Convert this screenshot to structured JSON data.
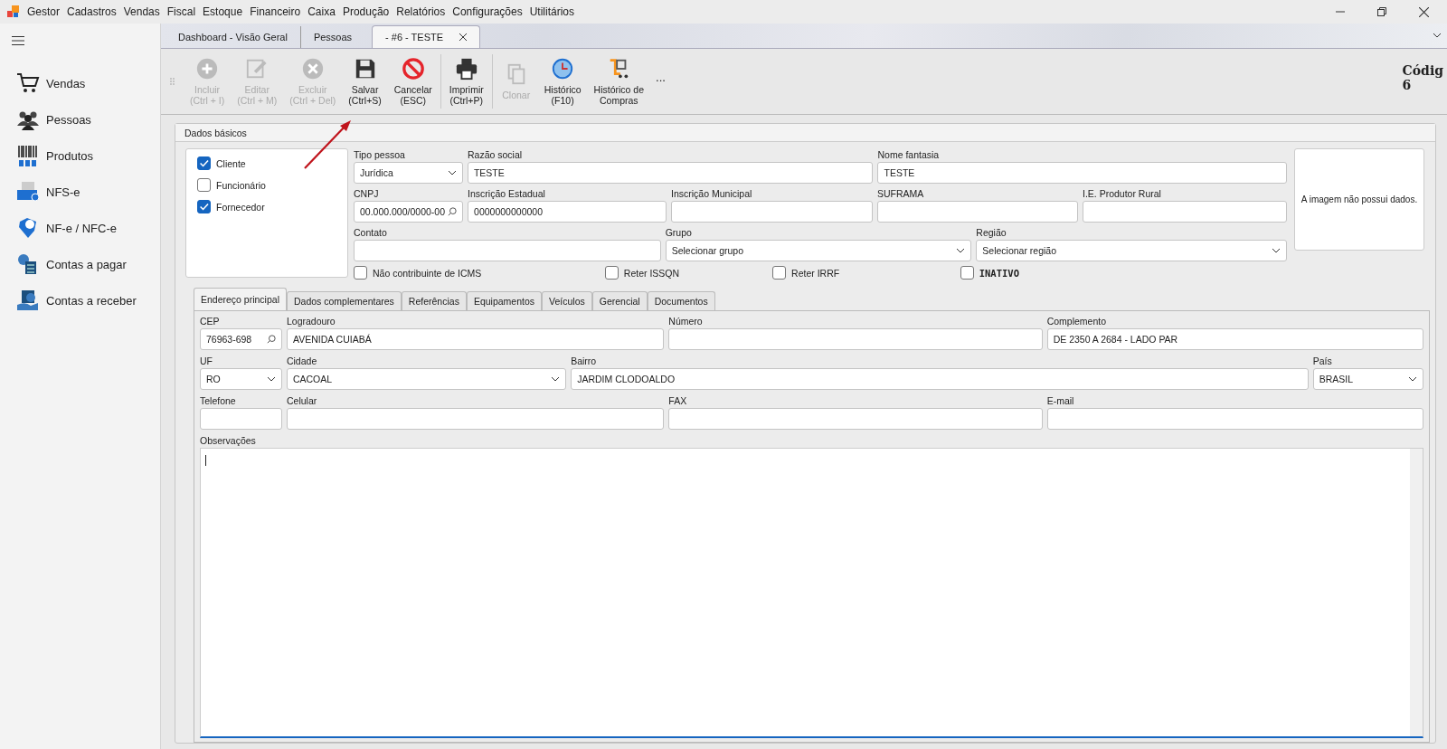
{
  "menu": {
    "app": "Gestor",
    "items": [
      "Cadastros",
      "Vendas",
      "Fiscal",
      "Estoque",
      "Financeiro",
      "Caixa",
      "Produção",
      "Relatórios",
      "Configurações",
      "Utilitários"
    ]
  },
  "doc_tabs": [
    {
      "label": "Dashboard - Visão Geral",
      "selected": false
    },
    {
      "label": "Pessoas",
      "selected": false
    },
    {
      "label": "- #6 - TESTE",
      "selected": true
    }
  ],
  "toolbar": {
    "groups": [
      [
        {
          "kind": "plus",
          "lines": [
            "Incluir",
            "(Ctrl + I)"
          ],
          "disabled": true
        },
        {
          "kind": "edit",
          "lines": [
            "Editar",
            "(Ctrl + M)"
          ],
          "disabled": true
        },
        {
          "kind": "delete",
          "lines": [
            "Excluir",
            "(Ctrl + Del)"
          ],
          "disabled": true
        },
        {
          "kind": "save",
          "lines": [
            "Salvar",
            "(Ctrl+S)"
          ],
          "disabled": false
        },
        {
          "kind": "cancel",
          "lines": [
            "Cancelar",
            "(ESC)"
          ],
          "disabled": false
        }
      ],
      [
        {
          "kind": "print",
          "lines": [
            "Imprimir",
            "(Ctrl+P)"
          ],
          "disabled": false
        }
      ],
      [
        {
          "kind": "clone",
          "lines": [
            "Clonar"
          ],
          "disabled": true
        },
        {
          "kind": "history",
          "lines": [
            "Histórico",
            "(F10)"
          ],
          "disabled": false
        },
        {
          "kind": "purchases",
          "lines": [
            "Histórico de",
            "Compras"
          ],
          "disabled": false
        }
      ]
    ],
    "more": "...",
    "code_label": "Códig",
    "code_value": "6"
  },
  "sidebar": {
    "items": [
      {
        "kind": "cart",
        "label": "Vendas"
      },
      {
        "kind": "people",
        "label": "Pessoas"
      },
      {
        "kind": "barcode",
        "label": "Produtos"
      },
      {
        "kind": "nfse",
        "label": "NFS-e"
      },
      {
        "kind": "nfe",
        "label": "NF-e / NFC-e"
      },
      {
        "kind": "pay",
        "label": "Contas a pagar"
      },
      {
        "kind": "receive",
        "label": "Contas a receber"
      }
    ]
  },
  "panel_title": "Dados básicos",
  "roles": [
    {
      "label": "Cliente",
      "checked": true
    },
    {
      "label": "Funcionário",
      "checked": false
    },
    {
      "label": "Fornecedor",
      "checked": true
    }
  ],
  "basic_rows": [
    [
      {
        "label": "Tipo pessoa",
        "kind": "select",
        "value": "Jurídica"
      },
      {
        "label": "Razão social",
        "kind": "text",
        "value": "TESTE"
      },
      {
        "label": "Nome fantasia",
        "kind": "text",
        "value": "TESTE"
      }
    ],
    [
      {
        "label": "CNPJ",
        "kind": "search",
        "value": "00.000.000/0000-00"
      },
      {
        "label": "Inscrição Estadual",
        "kind": "text",
        "value": "0000000000000"
      },
      {
        "label": "Inscrição Municipal",
        "kind": "text"
      },
      {
        "label": "SUFRAMA",
        "kind": "text"
      },
      {
        "label": "I.E. Produtor Rural",
        "kind": "text"
      }
    ],
    [
      {
        "label": "Contato",
        "kind": "text"
      },
      {
        "label": "Grupo",
        "kind": "select",
        "value": "Selecionar grupo"
      },
      {
        "label": "Região",
        "kind": "select",
        "value": "Selecionar região"
      }
    ]
  ],
  "options": [
    {
      "label": "Não contribuinte de ICMS",
      "checked": false,
      "kind": "option"
    },
    {
      "label": "Reter ISSQN",
      "checked": false,
      "kind": "option"
    },
    {
      "label": "Reter IRRF",
      "checked": false,
      "kind": "option"
    },
    {
      "label": "INATIVO",
      "checked": false,
      "kind": "flag"
    }
  ],
  "image_placeholder": "A imagem não possui dados.",
  "sub_tabs": [
    {
      "label": "Endereço principal",
      "selected": true
    },
    {
      "label": "Dados complementares",
      "selected": false
    },
    {
      "label": "Referências",
      "selected": false
    },
    {
      "label": "Equipamentos",
      "selected": false
    },
    {
      "label": "Veículos",
      "selected": false
    },
    {
      "label": "Gerencial",
      "selected": false
    },
    {
      "label": "Documentos",
      "selected": false
    }
  ],
  "address_rows": [
    [
      {
        "label": "CEP",
        "kind": "search",
        "value": "76963-698"
      },
      {
        "label": "Logradouro",
        "kind": "text",
        "value": "AVENIDA CUIABÁ"
      },
      {
        "label": "Número",
        "kind": "text"
      },
      {
        "label": "Complemento",
        "kind": "text",
        "value": "DE 2350 A 2684 - LADO PAR"
      }
    ],
    [
      {
        "label": "UF",
        "kind": "select",
        "value": "RO"
      },
      {
        "label": "Cidade",
        "kind": "select",
        "value": "CACOAL"
      },
      {
        "label": "Bairro",
        "kind": "text",
        "value": "JARDIM CLODOALDO"
      },
      {
        "label": "País",
        "kind": "select",
        "value": "BRASIL"
      }
    ],
    [
      {
        "label": "Telefone",
        "kind": "text"
      },
      {
        "label": "Celular",
        "kind": "text"
      },
      {
        "label": "FAX",
        "kind": "text"
      },
      {
        "label": "E-mail",
        "kind": "text"
      }
    ]
  ],
  "observations": {
    "label": "Observações",
    "focused": true
  }
}
